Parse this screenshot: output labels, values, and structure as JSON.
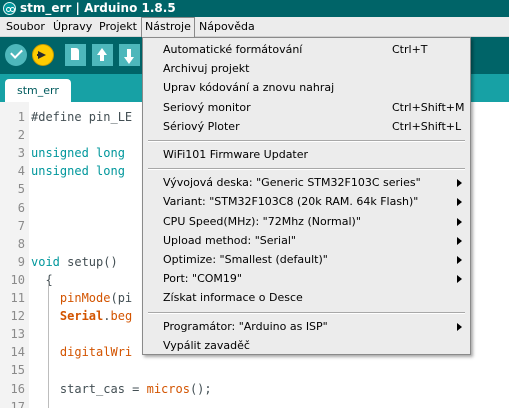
{
  "window": {
    "title": "stm_err | Arduino 1.8.5"
  },
  "menubar": {
    "items": [
      "Soubor",
      "Úpravy",
      "Projekt",
      "Nástroje",
      "Nápověda"
    ],
    "active": "Nástroje"
  },
  "toolbar": {
    "buttons": [
      "verify-icon",
      "upload-icon",
      "new-icon",
      "open-icon",
      "save-icon"
    ]
  },
  "tabs": [
    {
      "label": "stm_err"
    }
  ],
  "editor": {
    "line_numbers": [
      "1",
      "2",
      "3",
      "4",
      "5",
      "6",
      "7",
      "8",
      "9",
      "10",
      "11",
      "12",
      "13",
      "14",
      "15",
      "16",
      "17"
    ],
    "lines": [
      {
        "n": "1",
        "segs": [
          [
            "#define pin_LE",
            "plain"
          ]
        ]
      },
      {
        "n": "3",
        "segs": [
          [
            "unsigned long",
            "blue"
          ]
        ]
      },
      {
        "n": "4",
        "segs": [
          [
            "unsigned long",
            "blue"
          ]
        ]
      },
      {
        "n": "9",
        "segs": [
          [
            "void",
            "blue"
          ],
          [
            " setup()",
            "plain"
          ]
        ]
      },
      {
        "n": "10",
        "segs": [
          [
            "  {",
            "plain"
          ]
        ]
      },
      {
        "n": "11",
        "segs": [
          [
            "    ",
            "plain"
          ],
          [
            "pinMode",
            "orange"
          ],
          [
            "(pi",
            "plain"
          ]
        ]
      },
      {
        "n": "12",
        "segs": [
          [
            "    ",
            "plain"
          ],
          [
            "Serial",
            "orangeb"
          ],
          [
            ".",
            "plain"
          ],
          [
            "beg",
            "orange"
          ]
        ]
      },
      {
        "n": "14",
        "segs": [
          [
            "    ",
            "plain"
          ],
          [
            "digitalWri",
            "orange"
          ]
        ]
      },
      {
        "n": "16",
        "segs": [
          [
            "    start_cas = ",
            "plain"
          ],
          [
            "micros",
            "orange"
          ],
          [
            "();",
            "plain"
          ]
        ]
      }
    ]
  },
  "tools_menu": {
    "groups": [
      [
        {
          "label": "Automatické formátování",
          "shortcut": "Ctrl+T"
        },
        {
          "label": "Archivuj projekt"
        },
        {
          "label": "Uprav kódování a znovu nahraj"
        },
        {
          "label": "Seriový monitor",
          "shortcut": "Ctrl+Shift+M"
        },
        {
          "label": "Sériový Ploter",
          "shortcut": "Ctrl+Shift+L"
        }
      ],
      [
        {
          "label": "WiFi101 Firmware Updater"
        }
      ],
      [
        {
          "label": "Vývojová deska: \"Generic STM32F103C series\"",
          "submenu": true
        },
        {
          "label": "Variant: \"STM32F103C8 (20k RAM. 64k Flash)\"",
          "submenu": true
        },
        {
          "label": "CPU Speed(MHz): \"72Mhz (Normal)\"",
          "submenu": true
        },
        {
          "label": "Upload method: \"Serial\"",
          "submenu": true
        },
        {
          "label": "Optimize: \"Smallest (default)\"",
          "submenu": true
        },
        {
          "label": "Port: \"COM19\"",
          "submenu": true
        },
        {
          "label": "Získat informace o Desce"
        }
      ],
      [
        {
          "label": "Programátor: \"Arduino as ISP\"",
          "submenu": true
        },
        {
          "label": "Vypálit zavaděč"
        }
      ]
    ]
  }
}
